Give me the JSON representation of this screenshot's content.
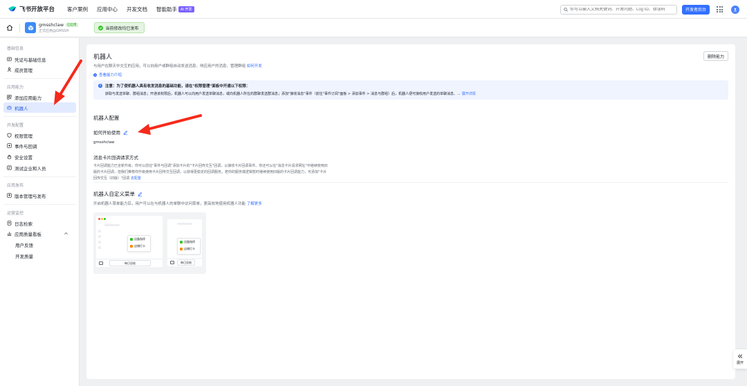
{
  "topnav": {
    "logo_text": "飞书开放平台",
    "links": [
      "客户案例",
      "应用中心",
      "开发文档",
      "智能助手"
    ],
    "ai_badge": "AI 开发",
    "search_placeholder": "你可以输入文档关键词、开发问题、Log ID、错误码",
    "console_button": "开发者后台",
    "icons": [
      "search-icon",
      "apps-grid-icon",
      "avatar-icon"
    ]
  },
  "app_header": {
    "app_name": "gmsshclaw",
    "status": "已启用",
    "app_sub": "正式应用@GMSSH",
    "publish_banner": "当前修改均已发布"
  },
  "sidebar": {
    "groups": [
      {
        "title": "基础信息",
        "items": [
          "凭证与基础信息",
          "成员管理"
        ]
      },
      {
        "title": "应用能力",
        "items": [
          "添加应用能力",
          "机器人"
        ]
      },
      {
        "title": "开发配置",
        "items": [
          "权限管理",
          "事件与回调",
          "安全设置",
          "测试企业和人员"
        ]
      },
      {
        "title": "应用发布",
        "items": [
          "版本管理与发布"
        ]
      },
      {
        "title": "运营监控",
        "items": [
          "日志检索",
          "应用质量看板"
        ]
      }
    ],
    "sub_items": [
      "用户反馈",
      "开发质量"
    ],
    "active_item": "机器人"
  },
  "main": {
    "title": "机器人",
    "desc": "与用户在聊天中交互的应用，可以向用户或群组自动发送消息、响应用户的消息、管理群组",
    "desc_link": "如何开发",
    "capability_link": "查看能力介绍",
    "delete_button": "删除能力",
    "notice_title": "注意：为了使机器人具有收发消息的基础功能，请在\"权限管理\"面板中开通以下权限：",
    "notice_body": "获取与发送单聊、群组消息；开通该权限后，机器人可以向用户发送单聊消息，或向机器人所在的群聊发送群消息；添加\"接收消息\"事件（前往\"事件订阅\"面板 > 添加事件 > 消息与群组）后，机器人便可接收用户发送的单聊消息、...",
    "notice_link": "展开详情",
    "config_title": "机器人配置",
    "how_to_title": "如何开始使用",
    "bot_name": "gmsshclaw",
    "callback_title": "消息卡片回调请求方式",
    "callback_para": "卡片回调能力已全新升级，你可以前往\"事件与回调\"添加卡片的\"卡片回传交互\"回调，以接收卡片回调事件。你还可以在\"消息卡片请求网址\"中继续使用旧版的卡片回调，但我们推荐你升级使用卡片回传交互回调，以获得更稳定的回调服务。若你的服务端逻辑暂时继续使用旧版的卡片回调能力，可添加\"卡片回传交互（旧版）\"回调",
    "callback_link": "去配置",
    "menu_title": "机器人自定义菜单",
    "menu_desc": "开启机器人菜单能力后，用户可以在与机器人的单聊中访问菜单，更高效地使用机器人功能",
    "menu_link": "了解更多"
  },
  "illustration": {
    "menu_item_1": "设备指停",
    "menu_item_2": "店铺打卡",
    "bottom_button": "每日总结"
  },
  "expand_button": "展开",
  "colors": {
    "primary": "#3370ff",
    "annotation_arrow": "#f52a1b",
    "success": "#34c724"
  }
}
